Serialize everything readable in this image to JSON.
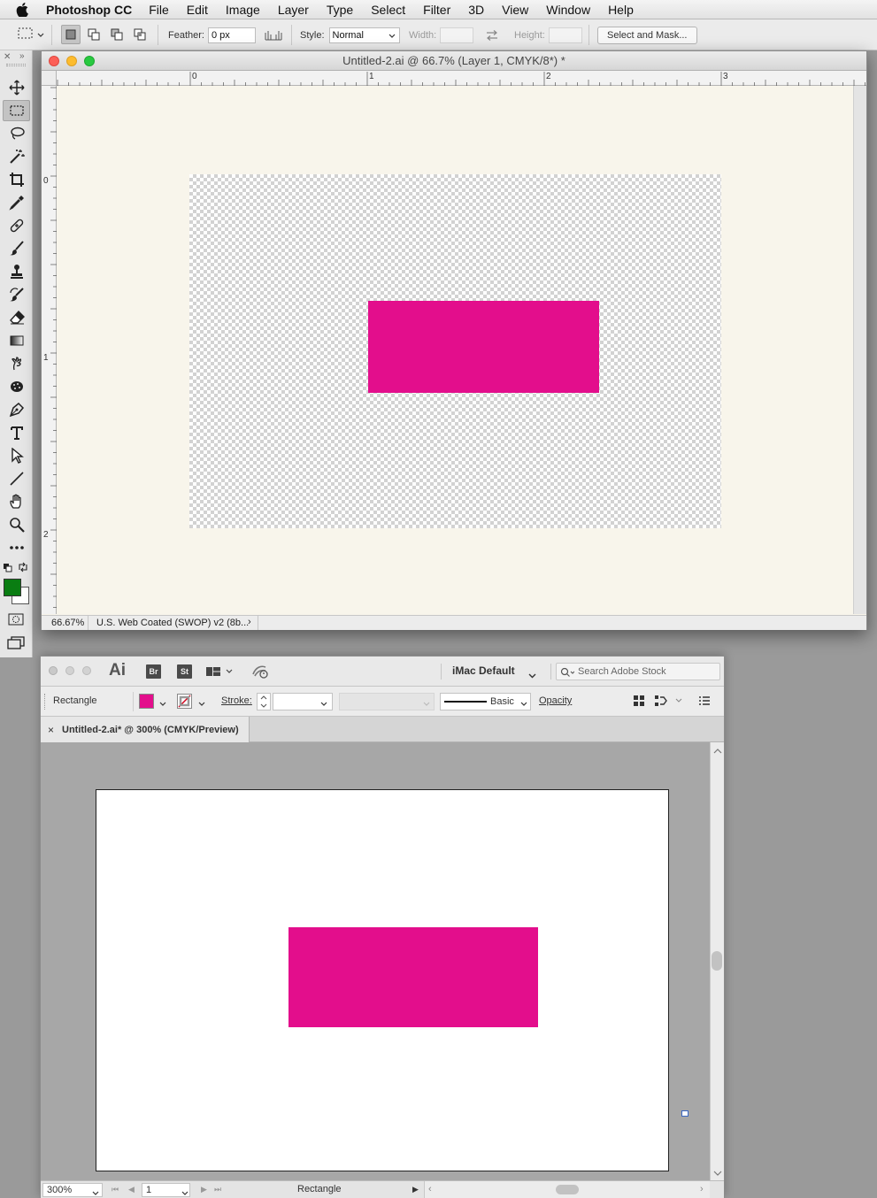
{
  "menubar": {
    "icon": "apple-icon",
    "items": [
      "Photoshop CC",
      "File",
      "Edit",
      "Image",
      "Layer",
      "Type",
      "Select",
      "Filter",
      "3D",
      "View",
      "Window",
      "Help"
    ]
  },
  "options_bar": {
    "feather_label": "Feather:",
    "feather_value": "0 px",
    "style_label": "Style:",
    "style_value": "Normal",
    "width_label": "Width:",
    "width_value": "",
    "height_label": "Height:",
    "height_value": "",
    "select_mask_label": "Select and Mask..."
  },
  "tools": {
    "icons": [
      "move-tool-icon",
      "rectangular-marquee-tool-icon",
      "lasso-tool-icon",
      "magic-wand-tool-icon",
      "crop-tool-icon",
      "eyedropper-tool-icon",
      "healing-brush-tool-icon",
      "brush-tool-icon",
      "clone-stamp-tool-icon",
      "history-brush-tool-icon",
      "eraser-tool-icon",
      "gradient-tool-icon",
      "smudge-tool-icon",
      "sponge-tool-icon",
      "pen-tool-icon",
      "type-tool-icon",
      "path-selection-tool-icon",
      "line-tool-icon",
      "hand-tool-icon",
      "zoom-tool-icon",
      "more-tools-icon"
    ],
    "foreground_color": "#0a7d12",
    "background_color": "#ffffff"
  },
  "ps_document": {
    "title": "Untitled-2.ai @ 66.7% (Layer 1, CMYK/8*) *",
    "ruler_h_labels": [
      "0",
      "1",
      "2",
      "3"
    ],
    "ruler_v_labels": [
      "0",
      "1",
      "2"
    ],
    "zoom": "66.67%",
    "profile": "U.S. Web Coated (SWOP) v2 (8b...",
    "canvas_bg": "#f8f5eb",
    "rect_color": "#e30e8c"
  },
  "ai_app": {
    "logo": "Ai",
    "badges": [
      "Br",
      "St"
    ],
    "workspace": "iMac Default",
    "search_placeholder": "Search Adobe Stock"
  },
  "ai_control": {
    "object_type": "Rectangle",
    "fill_color": "#e30e8c",
    "stroke_label": "Stroke:",
    "stroke_value": "",
    "brush_label": "Basic",
    "opacity_label": "Opacity"
  },
  "ai_document": {
    "tab_close": "×",
    "tab_title": "Untitled-2.ai* @ 300% (CMYK/Preview)",
    "rect_color": "#e30e8c"
  },
  "ai_status": {
    "zoom": "300%",
    "artboard_number": "1",
    "tool_label": "Rectangle"
  }
}
